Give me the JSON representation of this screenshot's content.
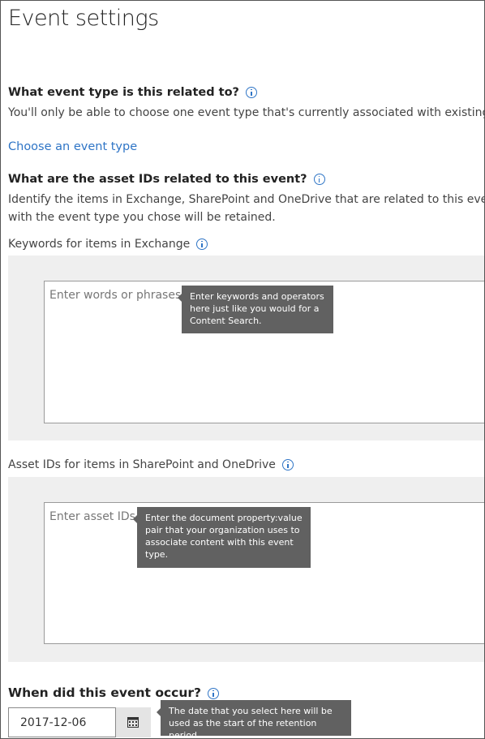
{
  "page": {
    "title": "Event settings"
  },
  "event_type": {
    "question": "What event type is this related to?",
    "description": "You'll only be able to choose one event type that's currently associated with existing la",
    "link": "Choose an event type"
  },
  "asset_ids": {
    "question": "What are the asset IDs related to this event?",
    "description_line1": "Identify the items in Exchange, SharePoint and OneDrive that are related to this event. (",
    "description_line2": "with the event type you chose will be retained."
  },
  "keywords": {
    "label": "Keywords for items in Exchange",
    "placeholder": "Enter words or phrases",
    "tooltip": "Enter keywords and operators here just like you would for a Content Search."
  },
  "sharepoint_ids": {
    "label": "Asset IDs for items in SharePoint and OneDrive",
    "placeholder": "Enter asset IDs",
    "tooltip": "Enter the document property:value pair that your organization uses to associate content with this event type."
  },
  "event_date": {
    "question": "When did this event occur?",
    "value": "2017-12-06",
    "tooltip": "The date that you select here will be used as the start of the retention period."
  },
  "icons": {
    "info": "info-icon",
    "calendar": "calendar-icon"
  },
  "colors": {
    "link": "#2f75c6",
    "tooltip_bg": "#616161",
    "panel_bg": "#efefef"
  }
}
